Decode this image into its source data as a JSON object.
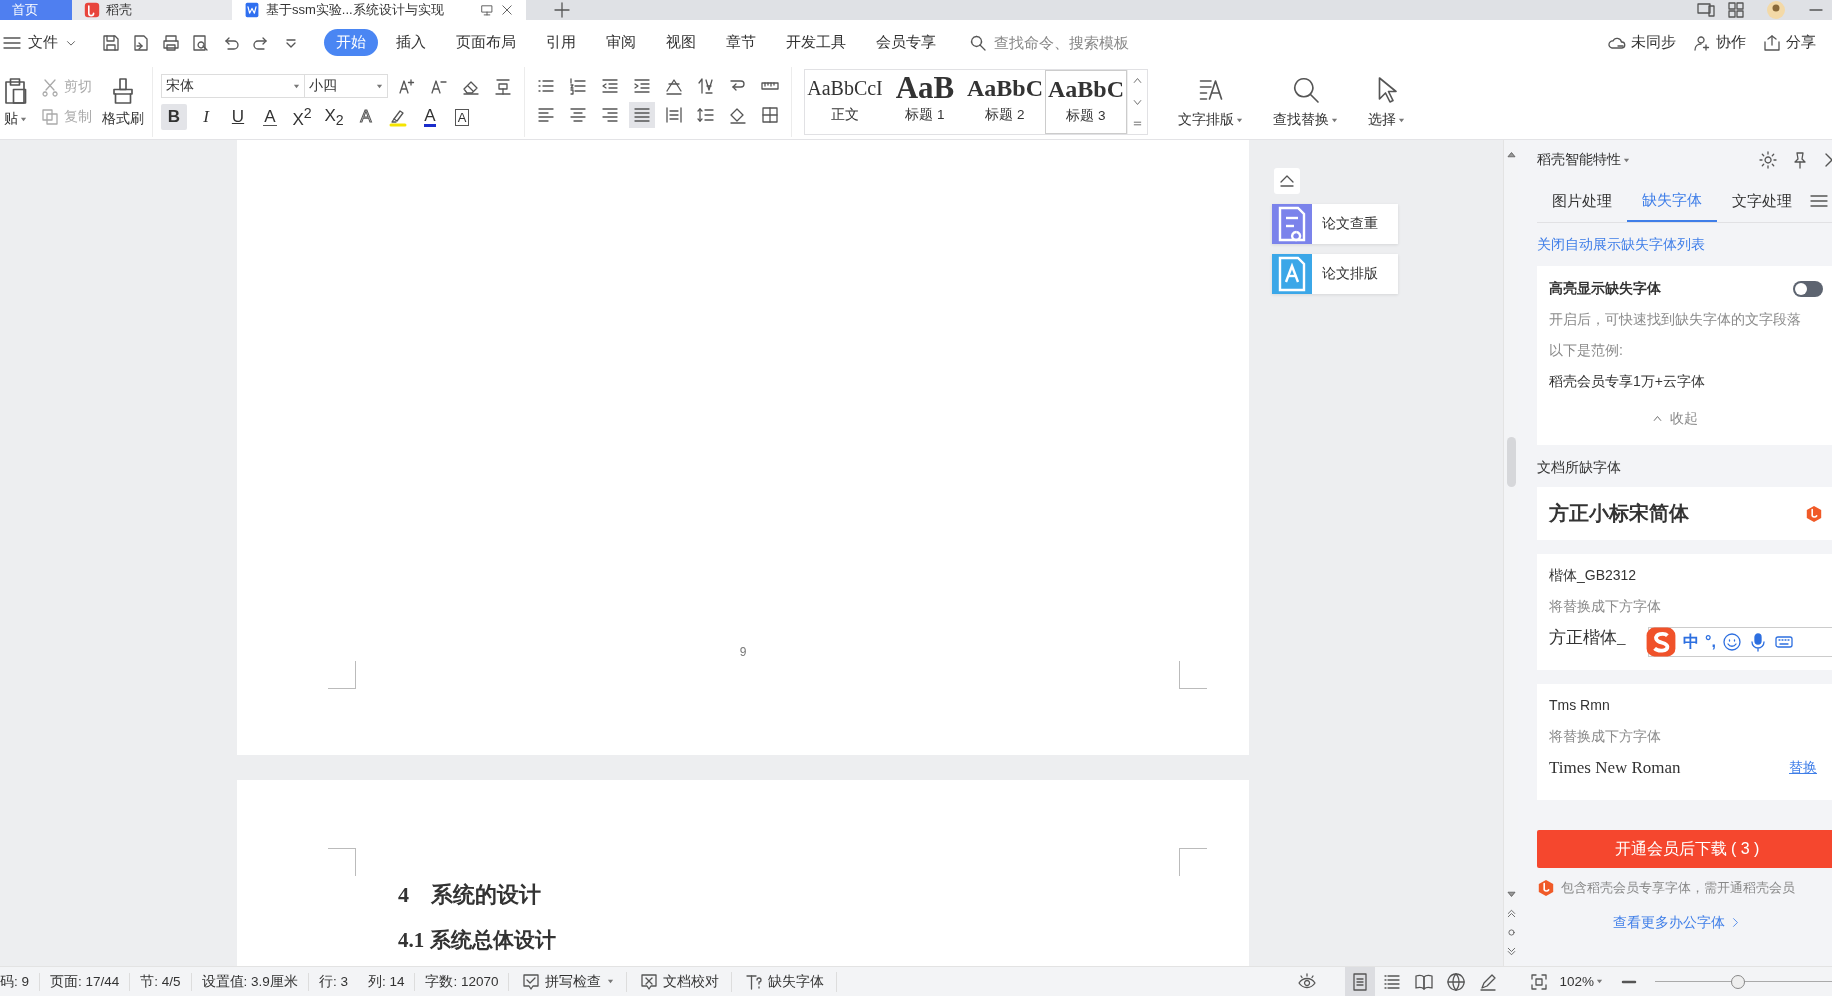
{
  "tab_bar": {
    "tabs": [
      {
        "kind": "home",
        "label": "首页",
        "selected": false
      },
      {
        "kind": "app",
        "label": "稻壳",
        "selected": false
      },
      {
        "kind": "document",
        "label": "基于ssm实验...系统设计与实现",
        "selected": true
      }
    ]
  },
  "menu_bar": {
    "file_menu": "文件",
    "tabs": [
      {
        "label": "开始",
        "selected": true
      },
      {
        "label": "插入",
        "selected": false
      },
      {
        "label": "页面布局",
        "selected": false
      },
      {
        "label": "引用",
        "selected": false
      },
      {
        "label": "审阅",
        "selected": false
      },
      {
        "label": "视图",
        "selected": false
      },
      {
        "label": "章节",
        "selected": false
      },
      {
        "label": "开发工具",
        "selected": false
      },
      {
        "label": "会员专享",
        "selected": false
      }
    ],
    "search": {
      "placeholder": "查找命令、搜索模板"
    },
    "actions": [
      {
        "kind": "sync",
        "label": "未同步"
      },
      {
        "kind": "collab",
        "label": "协作"
      },
      {
        "kind": "share",
        "label": "分享"
      }
    ]
  },
  "ribbon": {
    "clipboard": [
      {
        "kind": "paste",
        "label": "贴",
        "disabled": false
      },
      {
        "kind": "cut",
        "label": "剪切",
        "disabled": true
      },
      {
        "kind": "copy",
        "label": "复制",
        "disabled": true
      },
      {
        "kind": "painter",
        "label": "格式刷",
        "disabled": false
      }
    ],
    "font_name": "宋体",
    "font_size": "小四",
    "format_buttons": [
      {
        "kind": "bold",
        "label": "B",
        "active": true
      },
      {
        "kind": "italic",
        "label": "I",
        "active": false
      },
      {
        "kind": "underline",
        "label": "U",
        "active": false
      },
      {
        "kind": "strike",
        "label": "A",
        "active": false
      },
      {
        "kind": "super",
        "label": "X$^{2}$",
        "active": false
      },
      {
        "kind": "sub",
        "label": "X$_{2}$",
        "active": false
      },
      {
        "kind": "effect",
        "label": "A",
        "active": false
      },
      {
        "kind": "highlight",
        "active": false
      },
      {
        "kind": "color",
        "label": "A",
        "active": false
      },
      {
        "kind": "border",
        "label": "A",
        "active": false
      }
    ],
    "align_buttons": [
      {
        "kind": "left",
        "active": false
      },
      {
        "kind": "center",
        "active": false
      },
      {
        "kind": "right",
        "active": false
      },
      {
        "kind": "justify",
        "active": true
      },
      {
        "kind": "distribute",
        "active": false
      }
    ],
    "styles": [
      {
        "sample": "AaBbCcI",
        "label": "正文",
        "kind": "body",
        "selected": false
      },
      {
        "sample": "AaB",
        "label": "标题 1",
        "kind": "h1",
        "selected": false
      },
      {
        "sample": "AaBbC",
        "label": "标题 2",
        "kind": "h2",
        "selected": false
      },
      {
        "sample": "AaBbC",
        "label": "标题 3",
        "kind": "h3",
        "selected": true
      }
    ],
    "tools": [
      {
        "kind": "layout",
        "label": "文字排版"
      },
      {
        "kind": "find",
        "label": "查找替换"
      },
      {
        "kind": "select",
        "label": "选择"
      }
    ]
  },
  "document": {
    "pages": [
      {
        "kind": "blank",
        "page_number": "9"
      },
      {
        "kind": "text",
        "headings": [
          {
            "kind": "h1",
            "text": "4　系统的设计"
          },
          {
            "kind": "h2",
            "text": "4.1  系统总体设计"
          }
        ]
      }
    ]
  },
  "side_buttons": [
    {
      "kind": "check",
      "label": "论文查重"
    },
    {
      "kind": "format",
      "label": "论文排版"
    }
  ],
  "panel": {
    "title": "稻壳智能特性",
    "tabs": [
      {
        "label": "图片处理",
        "selected": false
      },
      {
        "label": "缺失字体",
        "selected": true
      },
      {
        "label": "文字处理",
        "selected": false
      }
    ],
    "link": "关闭自动展示缺失字体列表",
    "highlight_card": {
      "label": "高亮显示缺失字体",
      "on": false,
      "description": "开启后，可快速找到缺失字体的文字段落",
      "example_label": "以下是范例:",
      "example": "稻壳会员专享1万+云字体",
      "collapse": "收起"
    },
    "section": "文档所缺字体",
    "fonts": [
      {
        "kind": "premium",
        "name": "方正小标宋简体"
      },
      {
        "kind": "replace",
        "name": "楷体_GB2312",
        "hint": "将替换成下方字体",
        "replacement": "方正楷体_"
      },
      {
        "kind": "replace",
        "name": "Tms Rmn",
        "hint": "将替换成下方字体",
        "replacement": "Times New Roman",
        "action": "替换"
      }
    ],
    "download_button": "开通会员后下载 ( 3 )",
    "note": "包含稻壳会员专享字体，需开通稻壳会员",
    "more_link": "查看更多办公字体"
  },
  "ime_toolbar": {
    "items": [
      "中",
      "°,"
    ]
  },
  "status_bar": {
    "items": [
      "码: 9",
      "页面: 17/44",
      "节: 4/5",
      "设置值: 3.9厘米",
      "行: 3",
      "列: 14",
      "字数: 12070"
    ],
    "tools": [
      {
        "kind": "spell",
        "label": "拼写检查"
      },
      {
        "kind": "proof",
        "label": "文档校对"
      },
      {
        "kind": "font",
        "label": "缺失字体"
      }
    ],
    "views": [
      {
        "kind": "page",
        "selected": true
      },
      {
        "kind": "outline",
        "selected": false
      },
      {
        "kind": "reading",
        "selected": false
      },
      {
        "kind": "web",
        "selected": false
      },
      {
        "kind": "writing",
        "selected": false
      }
    ],
    "zoom": "102%",
    "zoom_slider": {
      "level": 0.47
    }
  }
}
